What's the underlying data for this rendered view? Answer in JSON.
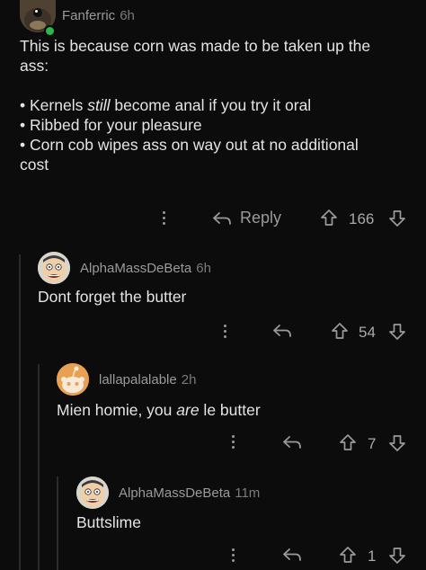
{
  "comments": [
    {
      "username": "Fanferric",
      "time": "6h",
      "text_line1": "This is because corn was made to be taken up the",
      "text_line2": "ass:",
      "bullets": [
        {
          "pre": "Kernels ",
          "em": "still",
          "post": " become anal if you try it oral"
        },
        {
          "pre": "Ribbed for your pleasure",
          "em": "",
          "post": ""
        },
        {
          "pre": "Corn cob wipes ass on way out at no additional",
          "em": "",
          "post": ""
        }
      ],
      "bullet_last_continuation": "cost",
      "reply_label": "Reply",
      "votes": "166"
    },
    {
      "username": "AlphaMassDeBeta",
      "time": "6h",
      "text": "Dont forget the butter",
      "votes": "54"
    },
    {
      "username": "lallapalalable",
      "time": "2h",
      "text_pre": "Mien homie, you ",
      "text_em": "are",
      "text_post": " le butter",
      "votes": "7"
    },
    {
      "username": "AlphaMassDeBeta",
      "time": "11m",
      "text": "Buttslime",
      "votes": "1"
    }
  ],
  "icons": {
    "more": "more-vertical-icon",
    "reply": "reply-arrow-icon",
    "upvote": "upvote-arrow-icon",
    "downvote": "downvote-arrow-icon"
  },
  "colors": {
    "background": "#0c0c0c",
    "text": "#e4e4e4",
    "meta": "#9a9a9a",
    "online_dot": "#2db84d",
    "thread_line": "#2b2b2b"
  }
}
